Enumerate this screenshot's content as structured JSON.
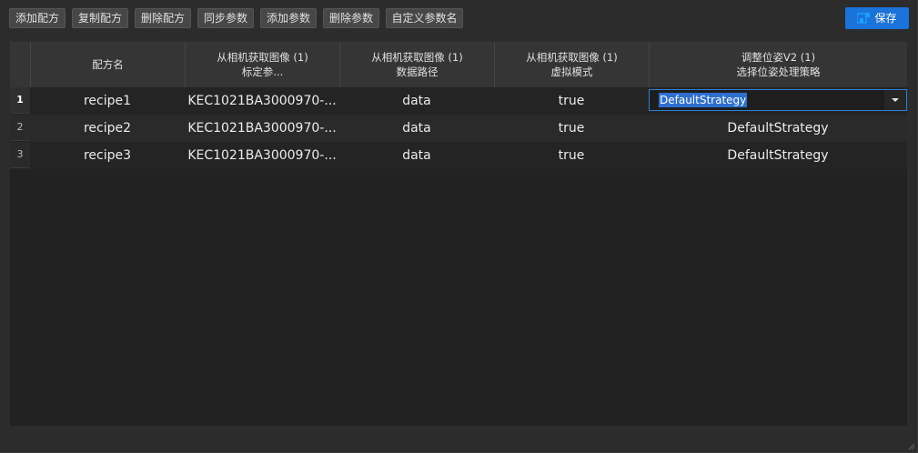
{
  "toolbar": {
    "buttons": [
      "添加配方",
      "复制配方",
      "删除配方",
      "同步参数",
      "添加参数",
      "删除参数",
      "自定义参数名"
    ],
    "save_label": "保存"
  },
  "grid": {
    "columns": [
      {
        "line1": "配方名",
        "line2": ""
      },
      {
        "line1": "从相机获取图像 (1)",
        "line2": "标定参..."
      },
      {
        "line1": "从相机获取图像 (1)",
        "line2": "数据路径"
      },
      {
        "line1": "从相机获取图像 (1)",
        "line2": "虚拟模式"
      },
      {
        "line1": "调整位姿V2 (1)",
        "line2": "选择位姿处理策略"
      }
    ],
    "rows": [
      {
        "num": "1",
        "cells": [
          "recipe1",
          "KEC1021BA3000970-...",
          "data",
          "true",
          "DefaultStrategy"
        ]
      },
      {
        "num": "2",
        "cells": [
          "recipe2",
          "KEC1021BA3000970-...",
          "data",
          "true",
          "DefaultStrategy"
        ]
      },
      {
        "num": "3",
        "cells": [
          "recipe3",
          "KEC1021BA3000970-...",
          "data",
          "true",
          "DefaultStrategy"
        ]
      }
    ],
    "editing_value": "DefaultStrategy"
  },
  "colors": {
    "accent": "#1a73d9",
    "background": "#2c2c2c",
    "header": "#353535"
  }
}
